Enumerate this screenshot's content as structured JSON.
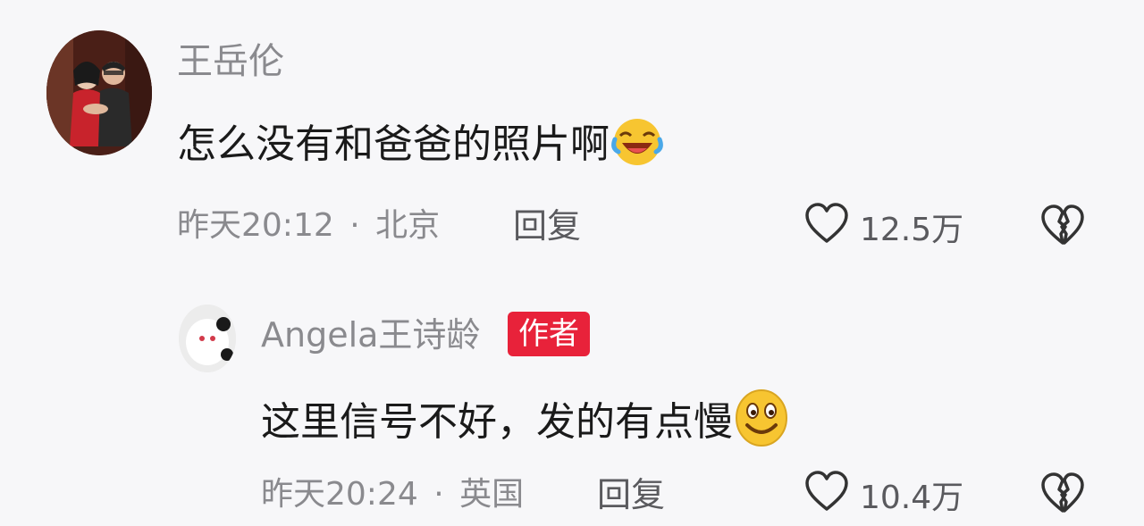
{
  "comments": [
    {
      "author": "王岳伦",
      "text": "怎么没有和爸爸的照片啊",
      "emoji": "laughing-tears-emoji",
      "time": "昨天20:12",
      "separator": "·",
      "location": "北京",
      "reply_label": "回复",
      "likes": "12.5万"
    },
    {
      "author": "Angela王诗龄",
      "badge": "作者",
      "text": "这里信号不好，发的有点慢",
      "emoji": "smiling-emoji",
      "time": "昨天20:24",
      "separator": "·",
      "location": "英国",
      "reply_label": "回复",
      "likes": "10.4万"
    }
  ],
  "colors": {
    "badge": "#e8223a",
    "background": "#f7f7f9",
    "text": "#1a1a1a",
    "muted": "#8a8a8e"
  }
}
